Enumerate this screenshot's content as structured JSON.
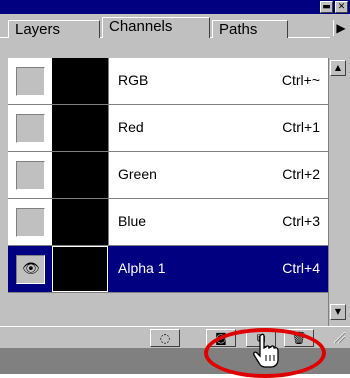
{
  "titlebar": {
    "minimize_icon": "minimize-icon",
    "close_icon": "close-icon",
    "minimize_glyph": "▬",
    "close_glyph": "✕"
  },
  "tabs": [
    {
      "label": "Layers",
      "active": false
    },
    {
      "label": "Channels",
      "active": true
    },
    {
      "label": "Paths",
      "active": false
    }
  ],
  "menu_arrow": "▶",
  "channels": [
    {
      "name": "RGB",
      "shortcut": "Ctrl+~",
      "visible": false,
      "selected": false
    },
    {
      "name": "Red",
      "shortcut": "Ctrl+1",
      "visible": false,
      "selected": false
    },
    {
      "name": "Green",
      "shortcut": "Ctrl+2",
      "visible": false,
      "selected": false
    },
    {
      "name": "Blue",
      "shortcut": "Ctrl+3",
      "visible": false,
      "selected": false
    },
    {
      "name": "Alpha 1",
      "shortcut": "Ctrl+4",
      "visible": true,
      "selected": true
    }
  ],
  "eye_glyph": "👁",
  "bottom_buttons": [
    {
      "name": "load-selection-button",
      "icon": "dotted-circle-icon",
      "glyph": "◌"
    },
    {
      "name": "save-selection-button",
      "icon": "mask-icon",
      "glyph": "◙"
    },
    {
      "name": "new-channel-button",
      "icon": "new-page-icon",
      "glyph": "⧉"
    },
    {
      "name": "delete-channel-button",
      "icon": "trash-icon",
      "glyph": "🗑"
    }
  ],
  "scroll": {
    "up_glyph": "▲",
    "down_glyph": "▼"
  },
  "colors": {
    "titlebar": "#000080",
    "selected_row": "#000080",
    "highlight": "#e00000",
    "panel": "#c0c0c0"
  }
}
